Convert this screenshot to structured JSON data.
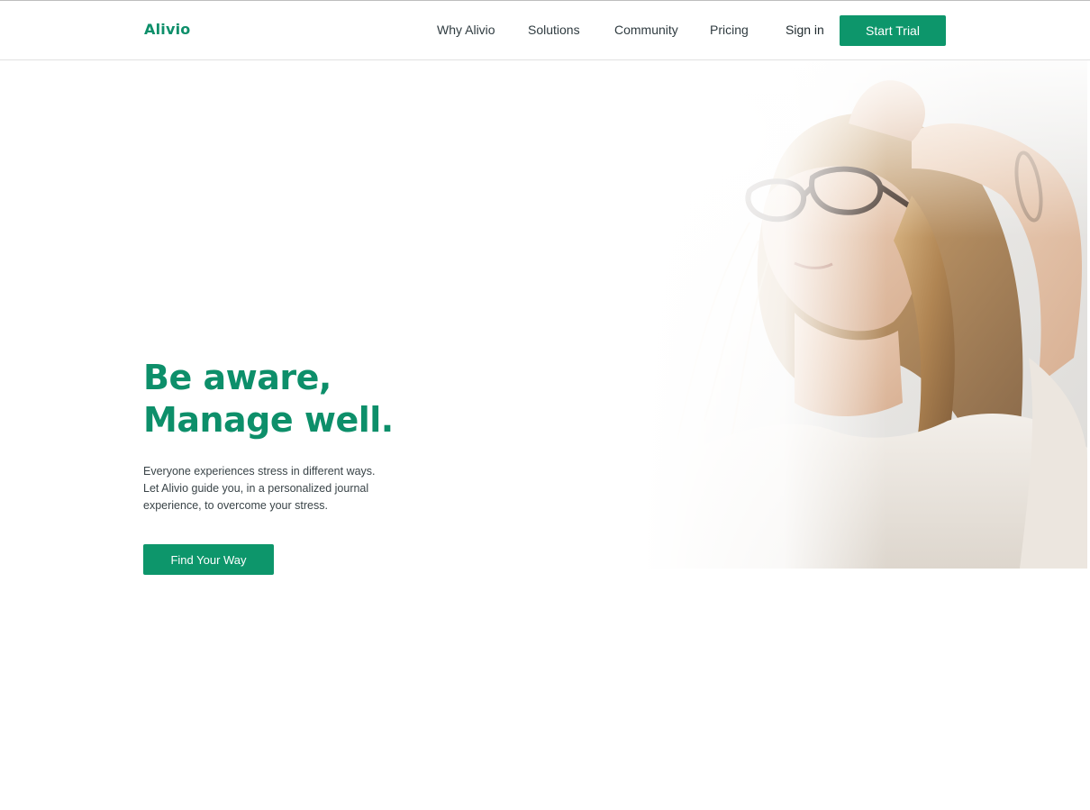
{
  "brand": {
    "name": "Alivio",
    "accent_color": "#0d966b"
  },
  "nav": {
    "links": [
      "Why Alivio",
      "Solutions",
      "Community",
      "Pricing"
    ],
    "sign_in": "Sign in",
    "cta": "Start Trial"
  },
  "hero": {
    "headline_line1": "Be aware,",
    "headline_line2": "Manage well.",
    "body_line1": "Everyone experiences stress in different ways.",
    "body_line2": "Let Alivio guide you, in a personalized journal",
    "body_line3": "experience, to overcome your stress.",
    "cta": "Find Your Way"
  }
}
